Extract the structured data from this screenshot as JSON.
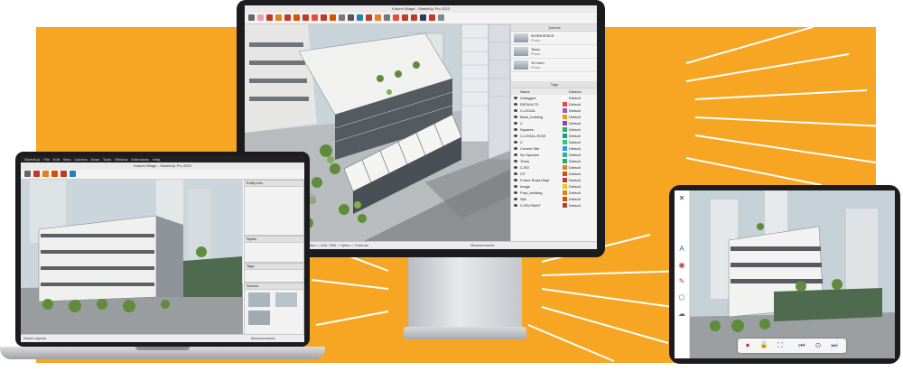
{
  "colors": {
    "background_accent": "#f6a623",
    "device_frame": "#1c1c1e",
    "ui_chrome": "#ececed",
    "sky": "#c9d3da",
    "building_white": "#f1f1f0",
    "building_dark": "#555a60",
    "foliage": "#5e8c3a",
    "street": "#8d8f91"
  },
  "monitor": {
    "window_title": "Kutumi Village - SketchUp Pro 2023",
    "scenes_panel": {
      "header": "Scenes",
      "items": [
        {
          "title": "WORKSPACE",
          "subtitle": "Photo"
        },
        {
          "title": "Team",
          "subtitle": "Photo"
        },
        {
          "title": "10 room",
          "subtitle": "Photo"
        }
      ]
    },
    "tags_panel": {
      "header": "Tags",
      "columns": [
        "Name",
        "Dashes"
      ],
      "rows": [
        {
          "name": "Untagged",
          "color": "#ffffff",
          "dash": "Default"
        },
        {
          "name": "DEFAULTS",
          "color": "#e74c3c",
          "dash": "Default"
        },
        {
          "name": "C-LEGAL",
          "color": "#9b59b6",
          "dash": "Default"
        },
        {
          "name": "Base_building",
          "color": "#f39c12",
          "dash": "Default"
        },
        {
          "name": "C",
          "color": "#8e44ad",
          "dash": "Default"
        },
        {
          "name": "Squares",
          "color": "#27ae60",
          "dash": "Default"
        },
        {
          "name": "C-LEGAL-ROW",
          "color": "#16a085",
          "dash": "Default"
        },
        {
          "name": "C",
          "color": "#2ecc71",
          "dash": "Default"
        },
        {
          "name": "Current Site",
          "color": "#3498db",
          "dash": "Default"
        },
        {
          "name": "No Squares",
          "color": "#1abc9c",
          "dash": "Default"
        },
        {
          "name": "Trees",
          "color": "#27ae60",
          "dash": "Default"
        },
        {
          "name": "C-RD",
          "color": "#e67e22",
          "dash": "Default"
        },
        {
          "name": "CP",
          "color": "#d35400",
          "dash": "Default"
        },
        {
          "name": "Future Road Mapt",
          "color": "#c0392b",
          "dash": "Default"
        },
        {
          "name": "Image",
          "color": "#f1c40f",
          "dash": "Default"
        },
        {
          "name": "Prop_building",
          "color": "#e67e22",
          "dash": "Default"
        },
        {
          "name": "Site",
          "color": "#d35400",
          "dash": "Default"
        },
        {
          "name": "C-RD-PAINT",
          "color": "#c0392b",
          "dash": "Default"
        }
      ]
    },
    "status_left": "Select objects. Shift = Add/Subtract, Option = Add. Shift + Option = Subtract",
    "status_right": "Measurements"
  },
  "laptop": {
    "menu_items": [
      "SketchUp",
      "File",
      "Edit",
      "View",
      "Camera",
      "Draw",
      "Tools",
      "Window",
      "Extensions",
      "Help"
    ],
    "window_title": "Kutumi Village - SketchUp Pro 2023",
    "panel_headers": [
      "Entity Info",
      "Styles",
      "Tags",
      "Scenes"
    ],
    "status_left": "Select objects",
    "status_right": "Measurements"
  },
  "tablet": {
    "close_label": "✕",
    "side_tools": [
      "A",
      "◉",
      "✎",
      "⬡",
      "☁"
    ],
    "controls": [
      "⏺",
      "🔒",
      "⛶",
      "⏮",
      "⊙",
      "⏭"
    ]
  }
}
